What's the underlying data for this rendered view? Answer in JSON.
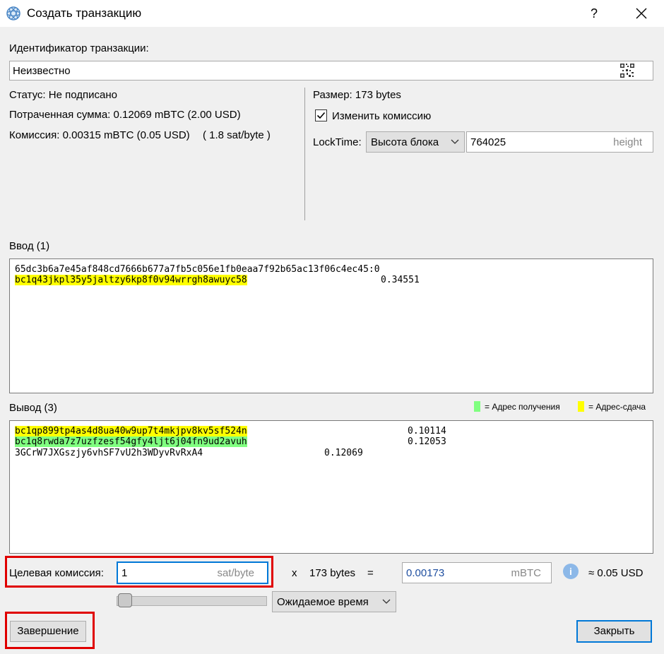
{
  "window": {
    "title": "Создать транзакцию",
    "help_label": "?",
    "close_label": "✕"
  },
  "transaction_id": {
    "label": "Идентификатор транзакции:",
    "value": "Неизвестно"
  },
  "info": {
    "status": "Статус: Не подписано",
    "amount_sent": "Потраченная сумма: 0.12069 mBTC (2.00 USD)",
    "fee": "Комиссия: 0.00315 mBTC (0.05 USD)",
    "fee_rate": "( 1.8 sat/byte )",
    "size": "Размер: 173 bytes",
    "edit_fee_label": "Изменить комиссию",
    "edit_fee_checked": true,
    "locktime_label": "LockTime:",
    "locktime_type": "Высота блока",
    "locktime_value": "764025",
    "locktime_unit": "height"
  },
  "inputs": {
    "label": "Ввод (1)",
    "prevout": "65dc3b6a7e45af848cd7666b677a7fb5c056e1fb0eaa7f92b65ac13f06c4ec45:0",
    "items": [
      {
        "address": "bc1q43jkpl35y5jaltzy6kp8f0v94wrrgh8awuyc58",
        "amount": "0.34551",
        "highlight": "yellow"
      }
    ]
  },
  "outputs": {
    "label": "Вывод (3)",
    "legend_receive": "= Адрес получения",
    "legend_change": "= Адрес-сдача",
    "items": [
      {
        "address": "bc1qp899tp4as4d8ua40w9up7t4mkjpv8kv5sf524n",
        "amount": "0.10114",
        "highlight": "yellow"
      },
      {
        "address": "bc1q8rwda7z7uzfzesf54gfy4ljt6j04fn9ud2avuh",
        "amount": "0.12053",
        "highlight": "green"
      },
      {
        "address": "3GCrW7JXGszjy6vhSF7vU2h3WDyvRvRxA4",
        "amount": "0.12069",
        "highlight": "none"
      }
    ]
  },
  "fee_controls": {
    "target_label": "Целевая комиссия:",
    "target_value": "1",
    "target_unit": "sat/byte",
    "multiply": "x",
    "size_text": "173 bytes",
    "equals": "=",
    "mbtc_value": "0.00173",
    "mbtc_unit": "mBTC",
    "info_icon": "i",
    "usd_text": "≈ 0.05 USD",
    "slider_position": 0,
    "wait_mode": "Ожидаемое время"
  },
  "buttons": {
    "finish": "Завершение",
    "close": "Закрыть"
  },
  "colors": {
    "change_highlight": "#ffff00",
    "receive_highlight": "#80ff80",
    "annotation_red": "#e00000",
    "focus_blue": "#0078d7"
  }
}
